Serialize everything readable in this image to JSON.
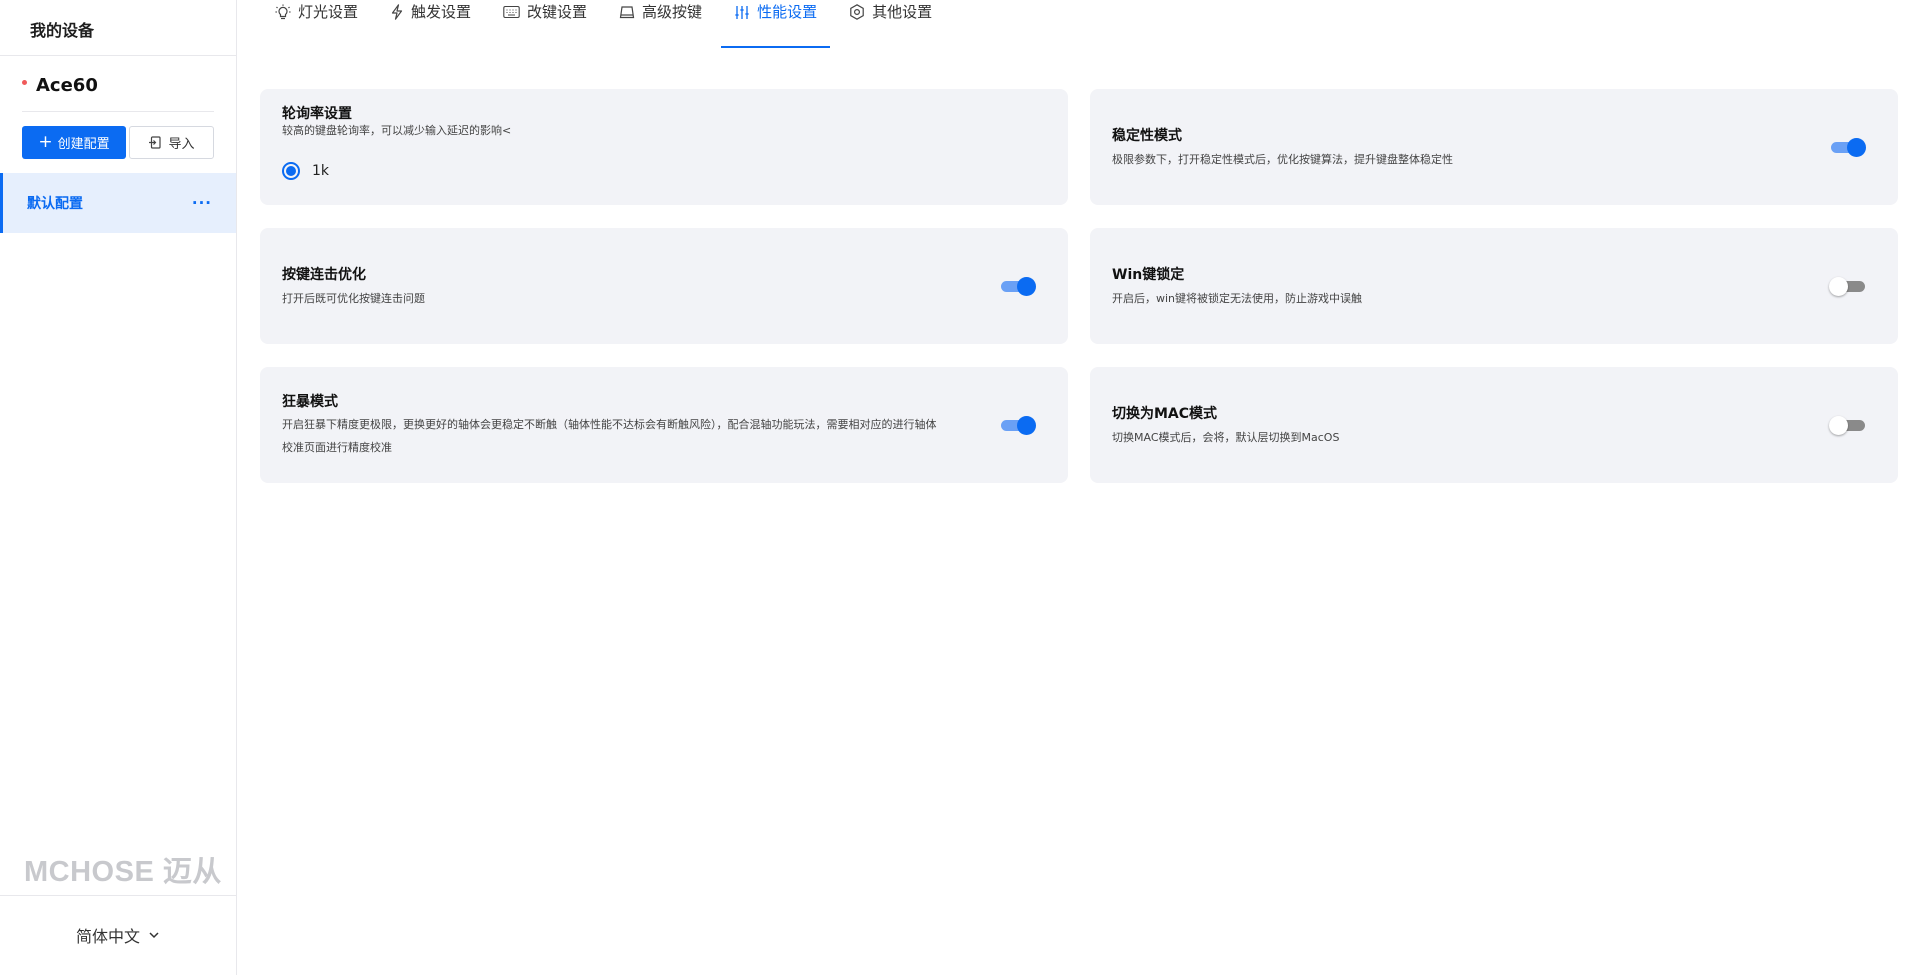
{
  "sidebar": {
    "title": "我的设备",
    "device_name": "Ace60",
    "create_button": "创建配置",
    "import_button": "导入",
    "profiles": [
      {
        "label": "默认配置",
        "more": "···"
      }
    ],
    "brand_logo": "MCHOSE 迈从",
    "language": "简体中文"
  },
  "tabs": [
    {
      "label": "灯光设置",
      "icon": "bulb-icon"
    },
    {
      "label": "触发设置",
      "icon": "lightning-icon"
    },
    {
      "label": "改键设置",
      "icon": "keyboard-icon"
    },
    {
      "label": "高级按键",
      "icon": "key-icon"
    },
    {
      "label": "性能设置",
      "icon": "sliders-icon",
      "active": true
    },
    {
      "label": "其他设置",
      "icon": "gear-icon"
    }
  ],
  "cards": {
    "polling": {
      "title": "轮询率设置",
      "desc": "较高的键盘轮询率，可以减少输入延迟的影响<",
      "option": "1k"
    },
    "stability": {
      "title": "稳定性模式",
      "desc": "极限参数下，打开稳定性模式后，优化按键算法，提升键盘整体稳定性",
      "enabled": true
    },
    "repeat": {
      "title": "按键连击优化",
      "desc": "打开后既可优化按键连击问题",
      "enabled": true
    },
    "winlock": {
      "title": "Win键锁定",
      "desc": "开启后，win键将被锁定无法使用，防止游戏中误触",
      "enabled": false
    },
    "berserk": {
      "title": "狂暴模式",
      "desc_line1": "开启狂暴下精度更极限，更换更好的轴体会更稳定不断触（轴体性能不达标会有断触风险），配合混轴功能玩法，需要相对应的进行轴体",
      "desc_line2": "校准页面进行精度校准",
      "enabled": true
    },
    "mac": {
      "title": "切换为MAC模式",
      "desc": "切换MAC模式后，会将，默认层切换到MacOS",
      "enabled": false
    }
  },
  "colors": {
    "accent": "#0b6bf2",
    "card_bg": "#f2f3f7",
    "selected_bg": "#e6effd"
  }
}
